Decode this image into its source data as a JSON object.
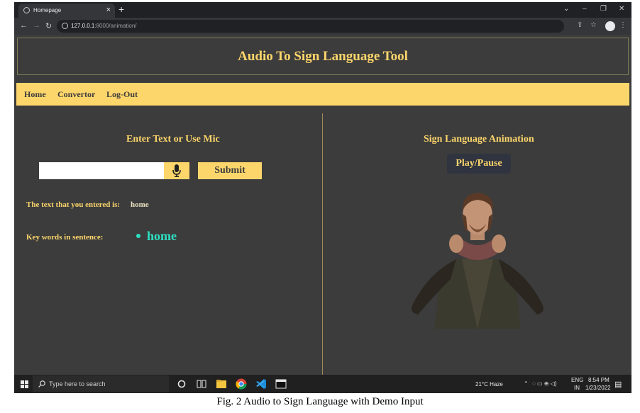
{
  "browser": {
    "tab_title": "Homepage",
    "tab_close": "×",
    "new_tab": "+",
    "url_host": "127.0.0.1",
    "url_rest": ":8000/animation/"
  },
  "page": {
    "title": "Audio To Sign Language Tool",
    "nav": [
      {
        "label": "Home"
      },
      {
        "label": "Convertor"
      },
      {
        "label": "Log-Out"
      }
    ]
  },
  "left_panel": {
    "heading": "Enter Text or Use Mic",
    "input_value": "",
    "submit_label": "Submit",
    "entered_label": "The text that you entered is:",
    "entered_value": "home",
    "keywords_label": "Key words in sentence:",
    "keywords": [
      "home"
    ]
  },
  "right_panel": {
    "heading": "Sign Language Animation",
    "play_pause_label": "Play/Pause"
  },
  "taskbar": {
    "search_placeholder": "Type here to search",
    "weather": "21°C  Haze",
    "lang_line1": "ENG",
    "lang_line2": "IN",
    "time": "8:54 PM",
    "date": "1/23/2022"
  },
  "caption": "Fig. 2 Audio to Sign Language with Demo Input",
  "colors": {
    "accent": "#fdd66b",
    "page_bg": "#3c3c3c",
    "keyword": "#2de0c2"
  }
}
